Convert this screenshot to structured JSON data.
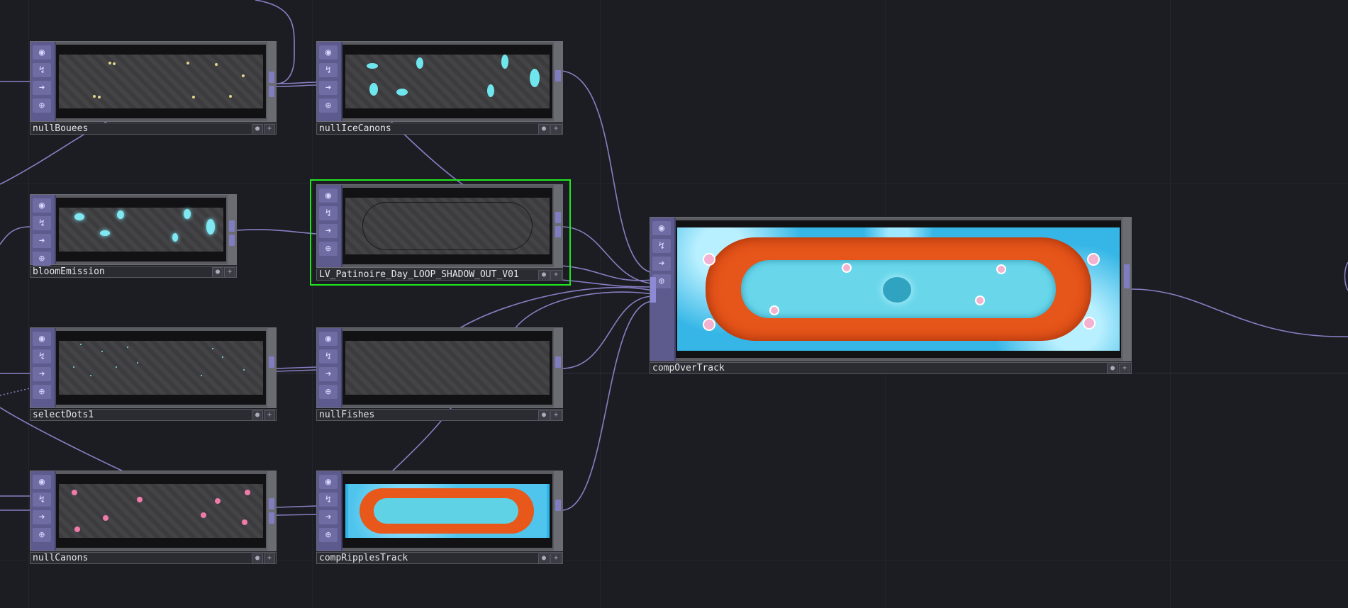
{
  "colors": {
    "background": "#1c1d22",
    "wire": "#9a90e0",
    "selection": "#1ee81e",
    "node_strip": "#5d5a8e"
  },
  "strip_icons": [
    "viewer-toggle-icon",
    "cook-flag-icon",
    "export-arrow-icon",
    "lock-icon"
  ],
  "nodes": {
    "nullBouees": {
      "name": "nullBouees"
    },
    "nullIceCanons": {
      "name": "nullIceCanons"
    },
    "bloomEmission": {
      "name": "bloomEmission"
    },
    "shadowOut": {
      "name": "LV_Patinoire_Day_LOOP_SHADOW_OUT_V01",
      "selected": true
    },
    "selectDots1": {
      "name": "selectDots1"
    },
    "nullFishes": {
      "name": "nullFishes"
    },
    "nullCanons": {
      "name": "nullCanons"
    },
    "compRipplesTrack": {
      "name": "compRipplesTrack"
    },
    "compOverTrack": {
      "name": "compOverTrack"
    }
  }
}
